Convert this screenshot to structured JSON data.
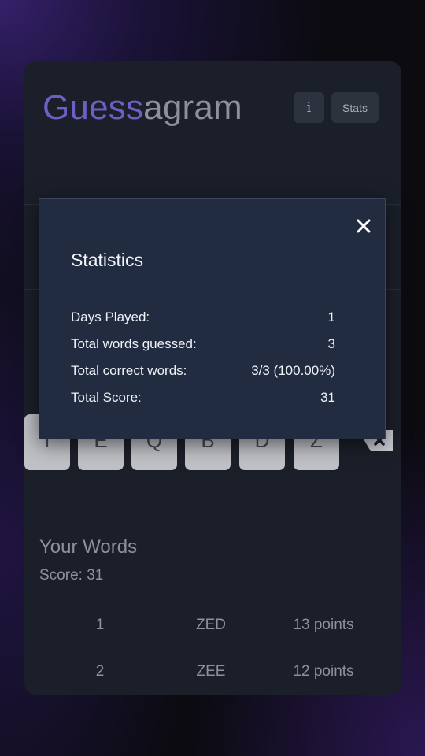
{
  "header": {
    "title_accent": "Guess",
    "title_rest": "agram",
    "info_label": "i",
    "stats_label": "Stats"
  },
  "keyboard": {
    "keys": [
      "T",
      "E",
      "Q",
      "B",
      "D",
      "Z"
    ],
    "backspace_icon": "backspace-icon"
  },
  "your_words": {
    "title": "Your Words",
    "score": "Score: 31",
    "rows": [
      {
        "num": "1",
        "word": "ZED",
        "points": "13 points"
      },
      {
        "num": "2",
        "word": "ZEE",
        "points": "12 points"
      }
    ]
  },
  "stats_modal": {
    "title": "Statistics",
    "close_icon": "close-icon",
    "rows": [
      {
        "label": "Days Played:",
        "value": "1"
      },
      {
        "label": "Total words guessed:",
        "value": "3"
      },
      {
        "label": "Total correct words:",
        "value": "3/3 (100.00%)"
      },
      {
        "label": "Total Score:",
        "value": "31"
      }
    ]
  },
  "colors": {
    "accent": "#6f5ec4",
    "card_bg": "#1b1f29",
    "modal_bg": "#212c40",
    "key_bg": "#bfc1c6"
  }
}
